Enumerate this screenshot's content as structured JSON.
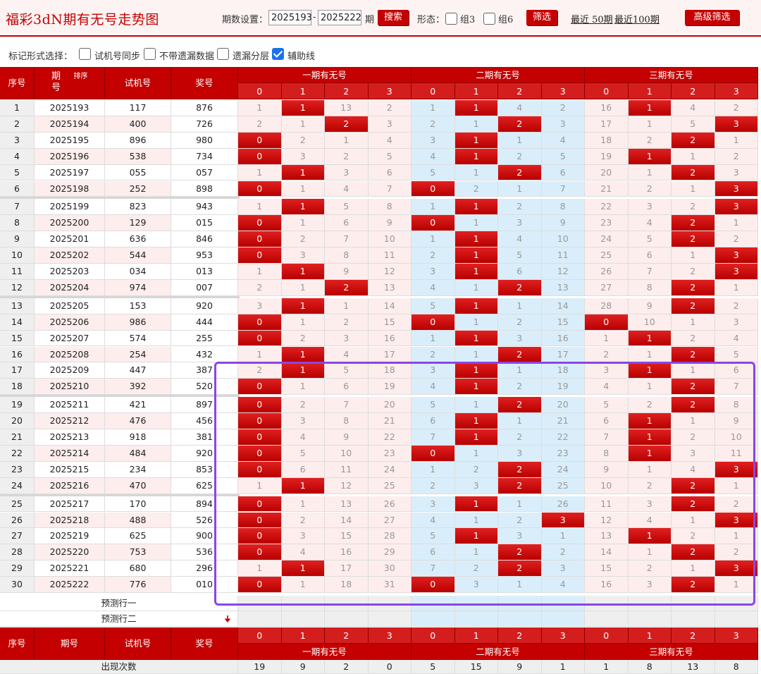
{
  "header": {
    "title": "福彩3dN期有无号走势图",
    "period_label": "期数设置：",
    "period_start": "2025193",
    "period_sep": "-",
    "period_end": "2025222",
    "period_unit": "期",
    "search_btn": "搜索",
    "form_label": "形态：",
    "group3": "组3",
    "group6": "组6",
    "filter_btn": "筛选",
    "recent50": "最近 50期",
    "recent100": "最近100期",
    "advanced_btn": "高级筛选"
  },
  "marks": {
    "label": "标记形式选择：",
    "opt1": "试机号同步",
    "opt2": "不带遗漏数据",
    "opt3": "遗漏分层",
    "opt4": "辅助线",
    "opt4_checked": true
  },
  "table": {
    "col_seq": "序号",
    "col_period": "期号",
    "col_sort": "排序",
    "col_trial": "试机号",
    "col_prize": "奖号",
    "groups": [
      "一期有无号",
      "二期有无号",
      "三期有无号"
    ],
    "digits": [
      "0",
      "1",
      "2",
      "3"
    ],
    "rows": [
      {
        "s": "1",
        "p": "2025193",
        "t": "117",
        "z": "876",
        "g": [
          [
            "1",
            "h1",
            "13",
            "2"
          ],
          [
            "1",
            "h1",
            "4",
            "2"
          ],
          [
            "16",
            "h1",
            "4",
            "2"
          ]
        ]
      },
      {
        "s": "2",
        "p": "2025194",
        "t": "400",
        "z": "726",
        "g": [
          [
            "2",
            "1",
            "h2",
            "3"
          ],
          [
            "2",
            "1",
            "h2",
            "3"
          ],
          [
            "17",
            "1",
            "5",
            "h3"
          ]
        ]
      },
      {
        "s": "3",
        "p": "2025195",
        "t": "896",
        "z": "980",
        "g": [
          [
            "h0",
            "2",
            "1",
            "4"
          ],
          [
            "3",
            "h1",
            "1",
            "4"
          ],
          [
            "18",
            "2",
            "h2",
            "1"
          ]
        ]
      },
      {
        "s": "4",
        "p": "2025196",
        "t": "538",
        "z": "734",
        "g": [
          [
            "h0",
            "3",
            "2",
            "5"
          ],
          [
            "4",
            "h1",
            "2",
            "5"
          ],
          [
            "19",
            "h1",
            "1",
            "2"
          ]
        ]
      },
      {
        "s": "5",
        "p": "2025197",
        "t": "055",
        "z": "057",
        "g": [
          [
            "1",
            "h1",
            "3",
            "6"
          ],
          [
            "5",
            "1",
            "h2",
            "6"
          ],
          [
            "20",
            "1",
            "h2",
            "3"
          ]
        ]
      },
      {
        "s": "6",
        "p": "2025198",
        "t": "252",
        "z": "898",
        "g": [
          [
            "h0",
            "1",
            "4",
            "7"
          ],
          [
            "h0",
            "2",
            "1",
            "7"
          ],
          [
            "21",
            "2",
            "1",
            "h3"
          ]
        ]
      },
      {
        "s": "7",
        "p": "2025199",
        "t": "823",
        "z": "943",
        "g": [
          [
            "1",
            "h1",
            "5",
            "8"
          ],
          [
            "1",
            "h1",
            "2",
            "8"
          ],
          [
            "22",
            "3",
            "2",
            "h3"
          ]
        ]
      },
      {
        "s": "8",
        "p": "2025200",
        "t": "129",
        "z": "015",
        "g": [
          [
            "h0",
            "1",
            "6",
            "9"
          ],
          [
            "h0",
            "1",
            "3",
            "9"
          ],
          [
            "23",
            "4",
            "h2",
            "1"
          ]
        ]
      },
      {
        "s": "9",
        "p": "2025201",
        "t": "636",
        "z": "846",
        "g": [
          [
            "h0",
            "2",
            "7",
            "10"
          ],
          [
            "1",
            "h1",
            "4",
            "10"
          ],
          [
            "24",
            "5",
            "h2",
            "2"
          ]
        ]
      },
      {
        "s": "10",
        "p": "2025202",
        "t": "544",
        "z": "953",
        "g": [
          [
            "h0",
            "3",
            "8",
            "11"
          ],
          [
            "2",
            "h1",
            "5",
            "11"
          ],
          [
            "25",
            "6",
            "1",
            "h3"
          ]
        ]
      },
      {
        "s": "11",
        "p": "2025203",
        "t": "034",
        "z": "013",
        "g": [
          [
            "1",
            "h1",
            "9",
            "12"
          ],
          [
            "3",
            "h1",
            "6",
            "12"
          ],
          [
            "26",
            "7",
            "2",
            "h3"
          ]
        ]
      },
      {
        "s": "12",
        "p": "2025204",
        "t": "974",
        "z": "007",
        "g": [
          [
            "2",
            "1",
            "h2",
            "13"
          ],
          [
            "4",
            "1",
            "h2",
            "13"
          ],
          [
            "27",
            "8",
            "h2",
            "1"
          ]
        ]
      },
      {
        "s": "13",
        "p": "2025205",
        "t": "153",
        "z": "920",
        "g": [
          [
            "3",
            "h1",
            "1",
            "14"
          ],
          [
            "5",
            "h1",
            "1",
            "14"
          ],
          [
            "28",
            "9",
            "h2",
            "2"
          ]
        ]
      },
      {
        "s": "14",
        "p": "2025206",
        "t": "986",
        "z": "444",
        "g": [
          [
            "h0",
            "1",
            "2",
            "15"
          ],
          [
            "h0",
            "1",
            "2",
            "15"
          ],
          [
            "h0",
            "10",
            "1",
            "3"
          ]
        ]
      },
      {
        "s": "15",
        "p": "2025207",
        "t": "574",
        "z": "255",
        "g": [
          [
            "h0",
            "2",
            "3",
            "16"
          ],
          [
            "1",
            "h1",
            "3",
            "16"
          ],
          [
            "1",
            "h1",
            "2",
            "4"
          ]
        ]
      },
      {
        "s": "16",
        "p": "2025208",
        "t": "254",
        "z": "432",
        "g": [
          [
            "1",
            "h1",
            "4",
            "17"
          ],
          [
            "2",
            "1",
            "h2",
            "17"
          ],
          [
            "2",
            "1",
            "h2",
            "5"
          ]
        ]
      },
      {
        "s": "17",
        "p": "2025209",
        "t": "447",
        "z": "387",
        "g": [
          [
            "2",
            "h1",
            "5",
            "18"
          ],
          [
            "3",
            "h1",
            "1",
            "18"
          ],
          [
            "3",
            "h1",
            "1",
            "6"
          ]
        ]
      },
      {
        "s": "18",
        "p": "2025210",
        "t": "392",
        "z": "520",
        "g": [
          [
            "h0",
            "1",
            "6",
            "19"
          ],
          [
            "4",
            "h1",
            "2",
            "19"
          ],
          [
            "4",
            "1",
            "h2",
            "7"
          ]
        ]
      },
      {
        "s": "19",
        "p": "2025211",
        "t": "421",
        "z": "897",
        "g": [
          [
            "h0",
            "2",
            "7",
            "20"
          ],
          [
            "5",
            "1",
            "h2",
            "20"
          ],
          [
            "5",
            "2",
            "h2",
            "8"
          ]
        ]
      },
      {
        "s": "20",
        "p": "2025212",
        "t": "476",
        "z": "456",
        "g": [
          [
            "h0",
            "3",
            "8",
            "21"
          ],
          [
            "6",
            "h1",
            "1",
            "21"
          ],
          [
            "6",
            "h1",
            "1",
            "9"
          ]
        ]
      },
      {
        "s": "21",
        "p": "2025213",
        "t": "918",
        "z": "381",
        "g": [
          [
            "h0",
            "4",
            "9",
            "22"
          ],
          [
            "7",
            "h1",
            "2",
            "22"
          ],
          [
            "7",
            "h1",
            "2",
            "10"
          ]
        ]
      },
      {
        "s": "22",
        "p": "2025214",
        "t": "484",
        "z": "920",
        "g": [
          [
            "h0",
            "5",
            "10",
            "23"
          ],
          [
            "h0",
            "1",
            "3",
            "23"
          ],
          [
            "8",
            "h1",
            "3",
            "11"
          ]
        ]
      },
      {
        "s": "23",
        "p": "2025215",
        "t": "234",
        "z": "853",
        "g": [
          [
            "h0",
            "6",
            "11",
            "24"
          ],
          [
            "1",
            "2",
            "h2",
            "24"
          ],
          [
            "9",
            "1",
            "4",
            "h3"
          ]
        ]
      },
      {
        "s": "24",
        "p": "2025216",
        "t": "470",
        "z": "625",
        "g": [
          [
            "1",
            "h1",
            "12",
            "25"
          ],
          [
            "2",
            "3",
            "h2",
            "25"
          ],
          [
            "10",
            "2",
            "h2",
            "1"
          ]
        ]
      },
      {
        "s": "25",
        "p": "2025217",
        "t": "170",
        "z": "894",
        "g": [
          [
            "h0",
            "1",
            "13",
            "26"
          ],
          [
            "3",
            "h1",
            "1",
            "26"
          ],
          [
            "11",
            "3",
            "h2",
            "2"
          ]
        ]
      },
      {
        "s": "26",
        "p": "2025218",
        "t": "488",
        "z": "526",
        "g": [
          [
            "h0",
            "2",
            "14",
            "27"
          ],
          [
            "4",
            "1",
            "2",
            "h3"
          ],
          [
            "12",
            "4",
            "1",
            "h3"
          ]
        ]
      },
      {
        "s": "27",
        "p": "2025219",
        "t": "625",
        "z": "900",
        "g": [
          [
            "h0",
            "3",
            "15",
            "28"
          ],
          [
            "5",
            "h1",
            "3",
            "1"
          ],
          [
            "13",
            "h1",
            "2",
            "1"
          ]
        ]
      },
      {
        "s": "28",
        "p": "2025220",
        "t": "753",
        "z": "536",
        "g": [
          [
            "h0",
            "4",
            "16",
            "29"
          ],
          [
            "6",
            "1",
            "h2",
            "2"
          ],
          [
            "14",
            "1",
            "h2",
            "2"
          ]
        ]
      },
      {
        "s": "29",
        "p": "2025221",
        "t": "680",
        "z": "296",
        "g": [
          [
            "1",
            "h1",
            "17",
            "30"
          ],
          [
            "7",
            "2",
            "h2",
            "3"
          ],
          [
            "15",
            "2",
            "1",
            "h3"
          ]
        ]
      },
      {
        "s": "30",
        "p": "2025222",
        "t": "776",
        "z": "010",
        "g": [
          [
            "h0",
            "1",
            "18",
            "31"
          ],
          [
            "h0",
            "3",
            "1",
            "4"
          ],
          [
            "16",
            "3",
            "h2",
            "1"
          ]
        ]
      }
    ],
    "predict1": "预测行一",
    "predict2": "预测行二",
    "predict_arrow": "🠋",
    "count_label": "出现次数",
    "counts": [
      "19",
      "9",
      "2",
      "0",
      "5",
      "15",
      "9",
      "1",
      "1",
      "8",
      "13",
      "8"
    ]
  }
}
